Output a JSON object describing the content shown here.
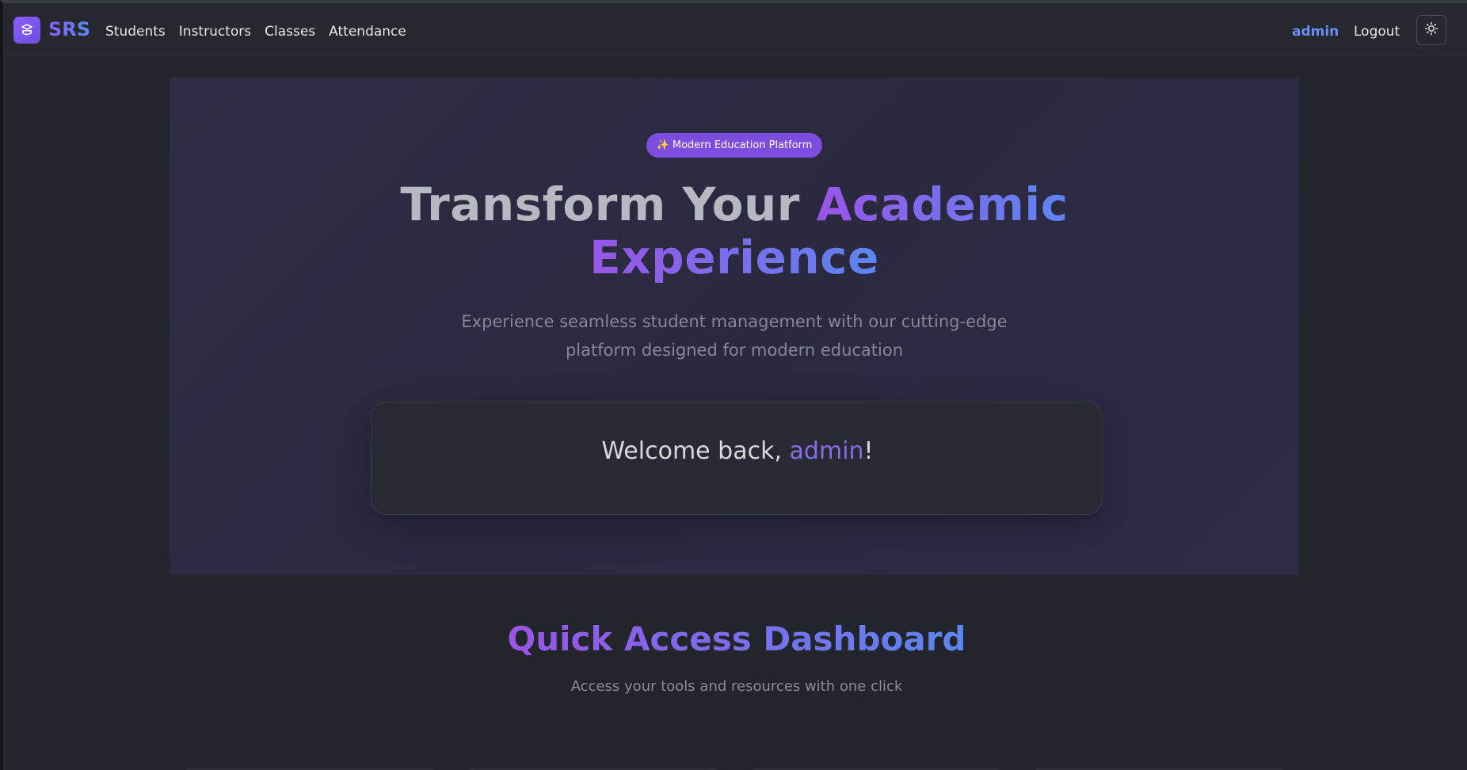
{
  "navbar": {
    "brand": "SRS",
    "brand_icon": "graduation-icon",
    "links": [
      "Students",
      "Instructors",
      "Classes",
      "Attendance"
    ],
    "user": "admin",
    "logout": "Logout",
    "theme_icon": "sun-icon"
  },
  "hero": {
    "badge": "✨ Modern Education Platform",
    "title_plain": "Transform Your",
    "title_accent_1": "Academic",
    "title_accent_2": "Experience",
    "subtitle_line1": "Experience seamless student management with our cutting-edge",
    "subtitle_line2": "platform designed for modern education",
    "welcome_prefix": "Welcome back,",
    "welcome_name": "admin",
    "welcome_suffix": "!"
  },
  "quick_access": {
    "title": "Quick Access Dashboard",
    "subtitle": "Access your tools and resources with one click"
  },
  "colors": {
    "background": "#22252b",
    "accent_purple": "#8b5cf6",
    "accent_blue": "#5b86f0",
    "user_link": "#6b8ff5"
  }
}
